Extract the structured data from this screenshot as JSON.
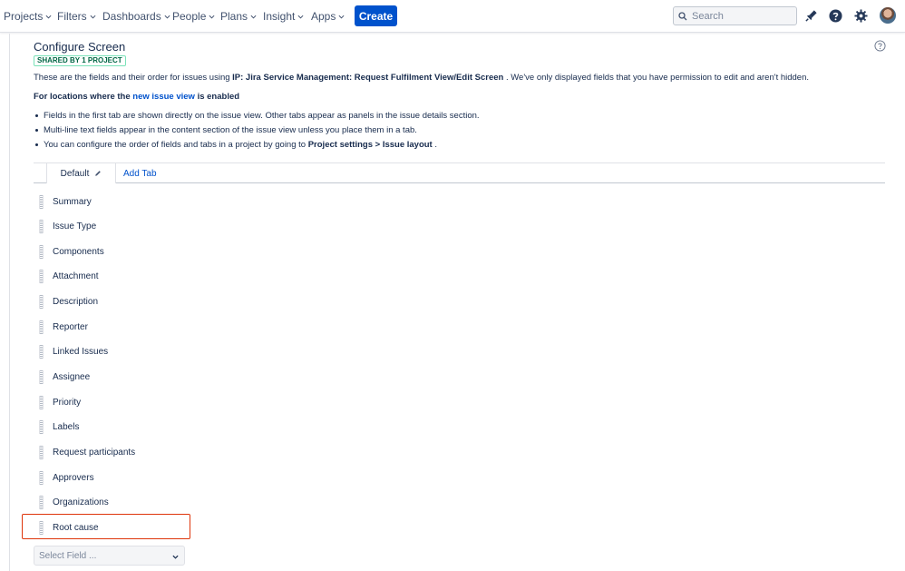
{
  "nav": {
    "items": [
      {
        "label": "Projects"
      },
      {
        "label": "Filters"
      },
      {
        "label": "Dashboards"
      },
      {
        "label": "People"
      },
      {
        "label": "Plans"
      },
      {
        "label": "Insight"
      },
      {
        "label": "Apps"
      }
    ],
    "create_label": "Create",
    "search_placeholder": "Search",
    "icons": [
      "search-icon",
      "notifications-icon",
      "help-icon",
      "settings-icon",
      "avatar"
    ]
  },
  "page": {
    "title": "Configure Screen",
    "shared_badge": "SHARED BY 1 PROJECT",
    "desc_prefix": "These are the fields and their order for issues using",
    "desc_screen": "IP: Jira Service Management: Request Fulfilment View/Edit Screen",
    "desc_suffix": ". We've only displayed fields that you have permission to edit and aren't hidden.",
    "locations_prefix": "For locations where the",
    "locations_link": "new issue view",
    "locations_suffix": "is enabled",
    "bullets": [
      "Fields in the first tab are shown directly on the issue view. Other tabs appear as panels in the issue details section.",
      "Multi-line text fields appear in the content section of the issue view unless you place them in a tab."
    ],
    "bullet3_prefix": "You can configure the order of fields and tabs in a project by going to",
    "bullet3_bold": "Project settings > Issue layout",
    "bullet3_suffix": "."
  },
  "tabs": {
    "active": "Default",
    "add_tab": "Add Tab"
  },
  "fields": [
    "Summary",
    "Issue Type",
    "Components",
    "Attachment",
    "Description",
    "Reporter",
    "Linked Issues",
    "Assignee",
    "Priority",
    "Labels",
    "Request participants",
    "Approvers",
    "Organizations",
    "Root cause"
  ],
  "select_field": {
    "placeholder": "Select Field ..."
  },
  "colors": {
    "brand": "#0052cc",
    "highlight": "#de350b",
    "badge": "#006644"
  }
}
